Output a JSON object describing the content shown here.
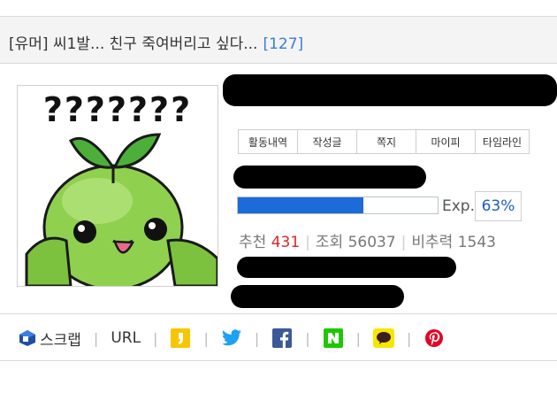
{
  "post": {
    "title": "[유머] 씨1발... 친구 죽여버리고 싶다...",
    "comment_count": "[127]"
  },
  "avatar": {
    "caption": "???????"
  },
  "profile": {
    "tabs": [
      {
        "label": "활동내역"
      },
      {
        "label": "작성글"
      },
      {
        "label": "쪽지"
      },
      {
        "label": "마이피"
      },
      {
        "label": "타임라인"
      }
    ],
    "exp_label": "Exp.",
    "exp_percent": "63%",
    "exp_value": 0.63,
    "stats": {
      "recommend_label": "추천",
      "recommend_value": "431",
      "views_label": "조회",
      "views_value": "56037",
      "ratio_label": "비추력",
      "ratio_value": "1543"
    }
  },
  "share": {
    "scrap_label": "스크랩",
    "url_label": "URL",
    "icons": [
      "scrap-icon",
      "kakaostory-icon",
      "twitter-icon",
      "facebook-icon",
      "naver-icon",
      "kakaotalk-icon",
      "pinterest-icon"
    ]
  },
  "colors": {
    "accent_blue": "#1c6bd8",
    "recommend_red": "#d9262c",
    "count_blue": "#3a7fd0"
  }
}
